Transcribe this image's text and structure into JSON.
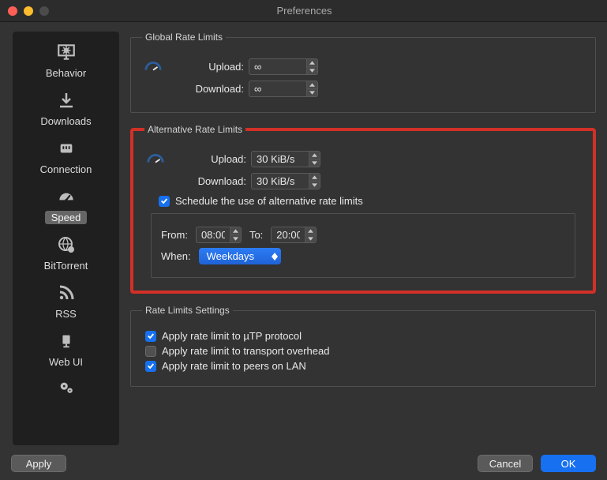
{
  "window": {
    "title": "Preferences"
  },
  "sidebar": {
    "items": [
      {
        "label": "Behavior"
      },
      {
        "label": "Downloads"
      },
      {
        "label": "Connection"
      },
      {
        "label": "Speed"
      },
      {
        "label": "BitTorrent"
      },
      {
        "label": "RSS"
      },
      {
        "label": "Web UI"
      }
    ]
  },
  "global": {
    "legend": "Global Rate Limits",
    "upload_label": "Upload:",
    "upload_value": "∞",
    "download_label": "Download:",
    "download_value": "∞"
  },
  "alt": {
    "legend": "Alternative Rate Limits",
    "upload_label": "Upload:",
    "upload_value": "30 KiB/s",
    "download_label": "Download:",
    "download_value": "30 KiB/s",
    "schedule_label": "Schedule the use of alternative rate limits",
    "from_label": "From:",
    "from_value": "08:00",
    "to_label": "To:",
    "to_value": "20:00",
    "when_label": "When:",
    "when_value": "Weekdays"
  },
  "settings": {
    "legend": "Rate Limits Settings",
    "utp_label": "Apply rate limit to µTP protocol",
    "overhead_label": "Apply rate limit to transport overhead",
    "lan_label": "Apply rate limit to peers on LAN"
  },
  "buttons": {
    "apply": "Apply",
    "cancel": "Cancel",
    "ok": "OK"
  }
}
